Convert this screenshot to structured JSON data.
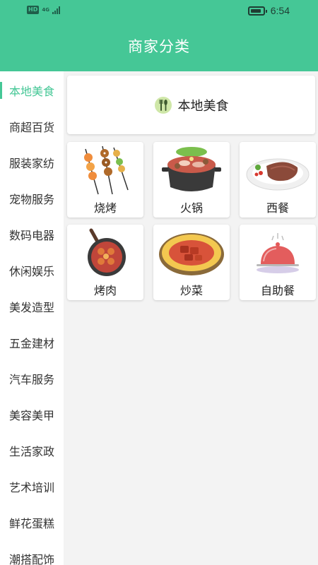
{
  "status_bar": {
    "hd_label": "HD",
    "network_label": "4G",
    "time": "6:54"
  },
  "header": {
    "title": "商家分类"
  },
  "sidebar": {
    "items": [
      {
        "label": "本地美食",
        "active": true
      },
      {
        "label": "商超百货"
      },
      {
        "label": "服装家纺"
      },
      {
        "label": "宠物服务"
      },
      {
        "label": "数码电器"
      },
      {
        "label": "休闲娱乐"
      },
      {
        "label": "美发造型"
      },
      {
        "label": "五金建材"
      },
      {
        "label": "汽车服务"
      },
      {
        "label": "美容美甲"
      },
      {
        "label": "生活家政"
      },
      {
        "label": "艺术培训"
      },
      {
        "label": "鲜花蛋糕"
      },
      {
        "label": "潮搭配饰"
      }
    ]
  },
  "main": {
    "section_title": "本地美食",
    "tiles": [
      {
        "label": "烧烤",
        "icon": "bbq-skewers-icon"
      },
      {
        "label": "火锅",
        "icon": "hotpot-icon"
      },
      {
        "label": "西餐",
        "icon": "steak-plate-icon"
      },
      {
        "label": "烤肉",
        "icon": "grill-pan-icon"
      },
      {
        "label": "炒菜",
        "icon": "stir-fry-dish-icon"
      },
      {
        "label": "自助餐",
        "icon": "buffet-cloche-icon"
      }
    ]
  },
  "colors": {
    "accent": "#45c796",
    "sidebar_bg": "#ffffff",
    "content_bg": "#f3f3f3"
  }
}
